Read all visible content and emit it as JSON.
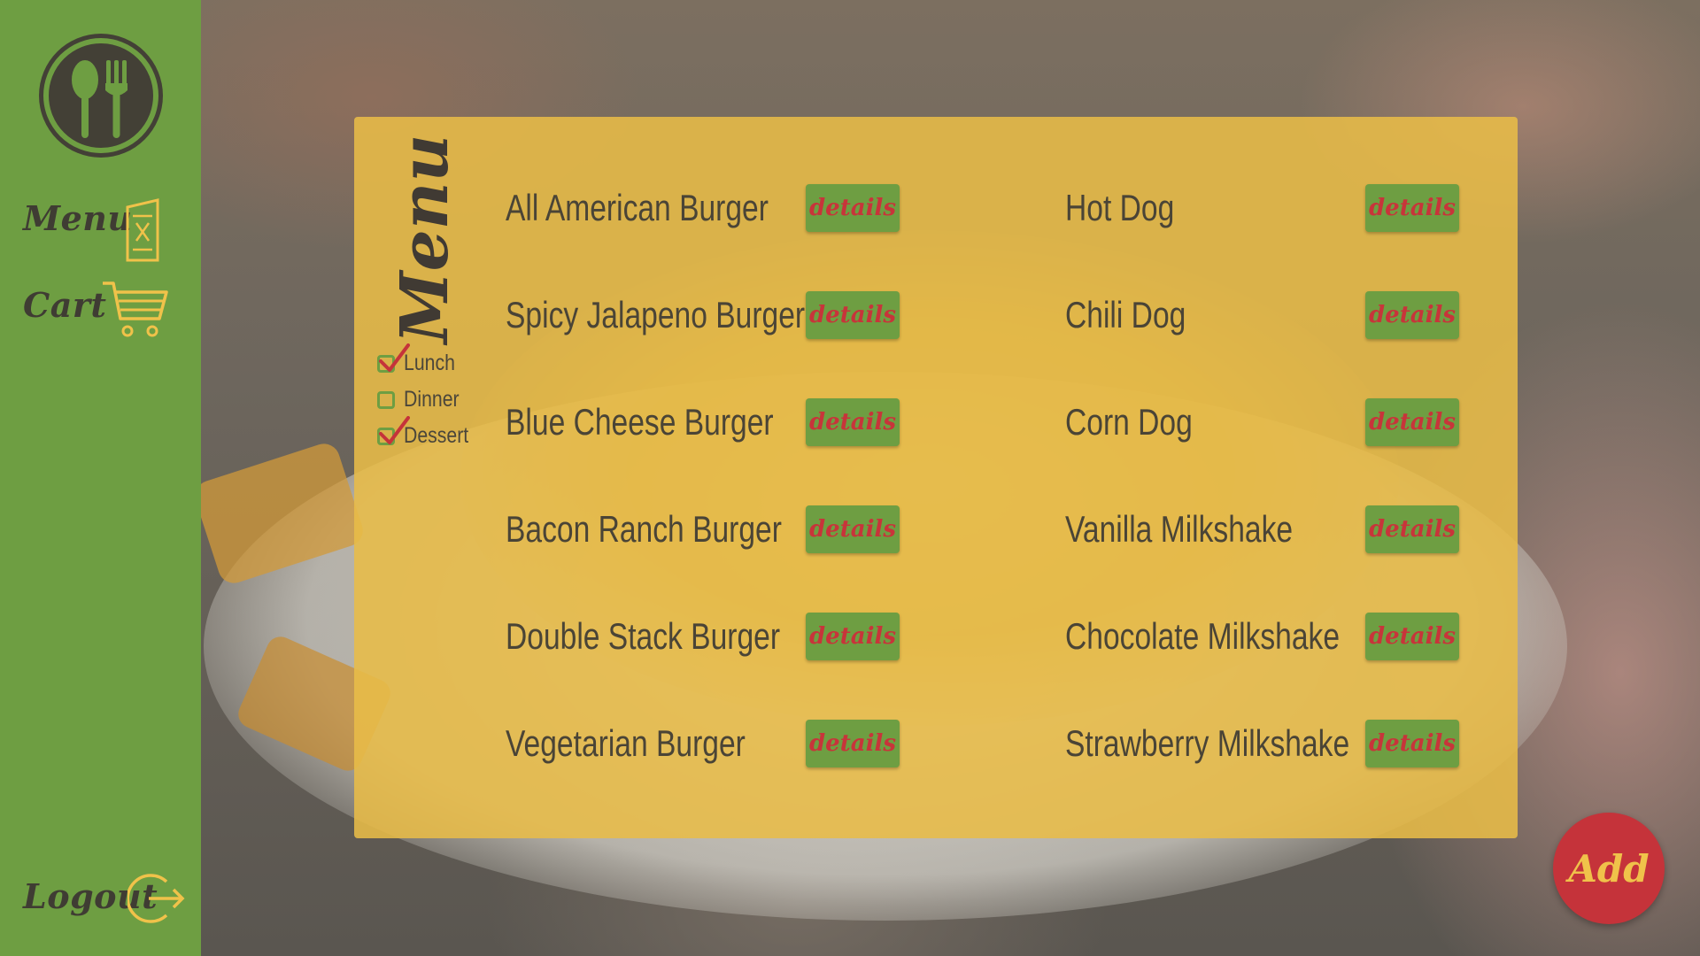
{
  "sidebar": {
    "items": [
      {
        "label": "Menu",
        "icon": "menu-card-icon"
      },
      {
        "label": "Cart",
        "icon": "shopping-cart-icon"
      },
      {
        "label": "Logout",
        "icon": "logout-icon"
      }
    ],
    "logo_icon": "spoon-fork-icon"
  },
  "panel": {
    "title": "Menu",
    "filters": [
      {
        "label": "Lunch",
        "checked": true
      },
      {
        "label": "Dinner",
        "checked": false
      },
      {
        "label": "Dessert",
        "checked": true
      }
    ],
    "columns": [
      {
        "items": [
          {
            "name": "All American Burger",
            "button": "details"
          },
          {
            "name": "Spicy Jalapeno Burger",
            "button": "details"
          },
          {
            "name": "Blue Cheese Burger",
            "button": "details"
          },
          {
            "name": "Bacon Ranch Burger",
            "button": "details"
          },
          {
            "name": "Double Stack Burger",
            "button": "details"
          },
          {
            "name": "Vegetarian Burger",
            "button": "details"
          }
        ]
      },
      {
        "items": [
          {
            "name": "Hot Dog",
            "button": "details"
          },
          {
            "name": "Chili Dog",
            "button": "details"
          },
          {
            "name": "Corn Dog",
            "button": "details"
          },
          {
            "name": "Vanilla Milkshake",
            "button": "details"
          },
          {
            "name": "Chocolate Milkshake",
            "button": "details"
          },
          {
            "name": "Strawberry Milkshake",
            "button": "details"
          }
        ]
      }
    ]
  },
  "add_button": {
    "label": "Add"
  },
  "colors": {
    "sidebar": "#6e9e42",
    "panel": "#e8bc48",
    "accent_red": "#c5333a",
    "text_dark": "#403a33",
    "icon_yellow": "#f0c24a"
  }
}
